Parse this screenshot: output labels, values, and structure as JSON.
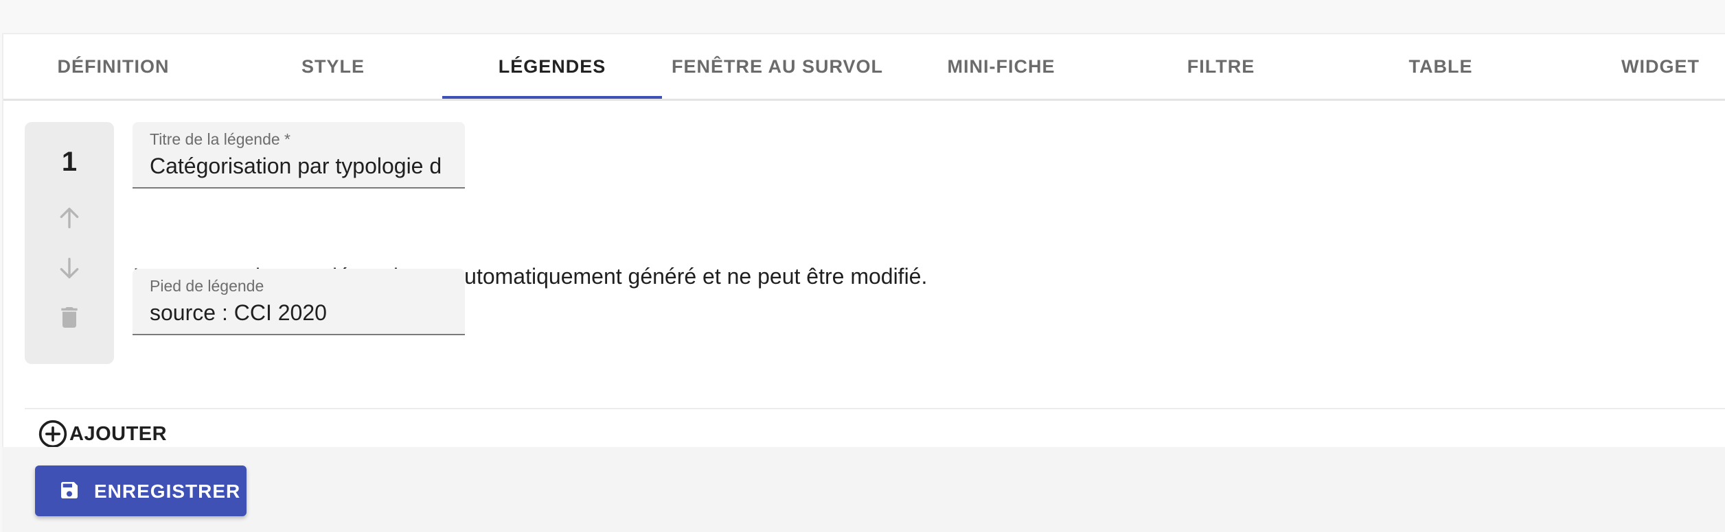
{
  "tabs": [
    {
      "label": "DÉFINITION",
      "active": false
    },
    {
      "label": "STYLE",
      "active": false
    },
    {
      "label": "LÉGENDES",
      "active": true
    },
    {
      "label": "FENÊTRE AU SURVOL",
      "active": false
    },
    {
      "label": "MINI-FICHE",
      "active": false
    },
    {
      "label": "FILTRE",
      "active": false
    },
    {
      "label": "TABLE",
      "active": false
    },
    {
      "label": "WIDGET",
      "active": false
    }
  ],
  "legend": {
    "rank": "1",
    "title_field": {
      "label": "Titre de la légende *",
      "value": "Catégorisation par typologie d"
    },
    "auto_note": "Le contenu de cette légende est automatiquement généré et ne peut être modifié.",
    "footer_field": {
      "label": "Pied de légende",
      "value": "source : CCI 2020"
    },
    "icons": {
      "move_up": "arrow-up-icon",
      "move_down": "arrow-down-icon",
      "delete": "trash-icon"
    }
  },
  "actions": {
    "add_label": "AJOUTER",
    "add_icon": "plus-circle-icon",
    "save_label": "ENREGISTRER",
    "save_icon": "floppy-disk-icon"
  },
  "colors": {
    "accent": "#3f51b5",
    "tab_active_text": "#222222",
    "tab_inactive_text": "#6b6b6b",
    "disabled_icon": "#b5b5b5"
  }
}
